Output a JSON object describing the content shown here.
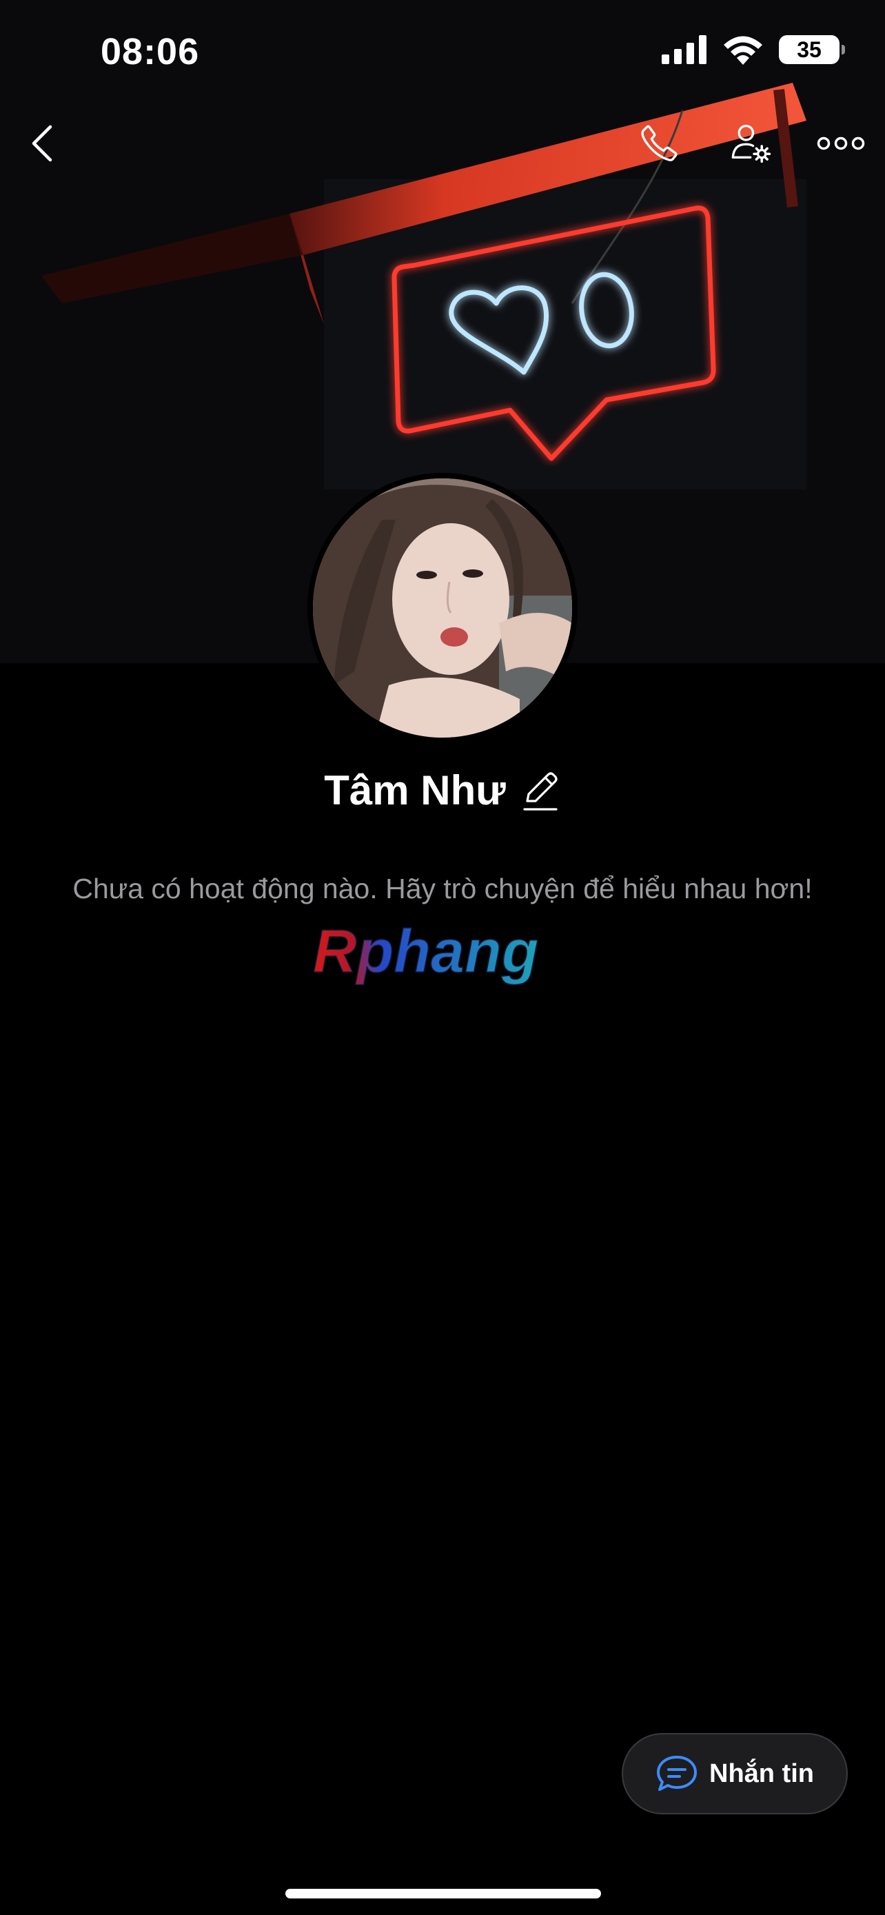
{
  "status_bar": {
    "time": "08:06",
    "battery_level": "35",
    "icons": [
      "cellular-signal-icon",
      "wifi-icon",
      "battery-icon"
    ]
  },
  "nav": {
    "back_icon": "chevron-left-icon",
    "call_icon": "phone-icon",
    "settings_icon": "user-settings-icon",
    "more_icon": "more-dots-icon"
  },
  "cover": {
    "description_icon": "neon-like-sign",
    "like_count": "0"
  },
  "profile": {
    "name": "Tâm Như",
    "edit_icon": "pencil-icon"
  },
  "activity": {
    "empty_message": "Chưa có hoạt động nào. Hãy trò chuyện để hiểu nhau hơn!"
  },
  "watermark": {
    "text": "Rphang"
  },
  "message_button": {
    "label": "Nhắn tin",
    "icon": "chat-bubble-icon"
  },
  "colors": {
    "background": "#000000",
    "neon_red": "#ff3b2f",
    "neon_blue": "#bfe6ff",
    "muted_text": "#9a9a9f",
    "accent_blue": "#3d8bfd"
  }
}
